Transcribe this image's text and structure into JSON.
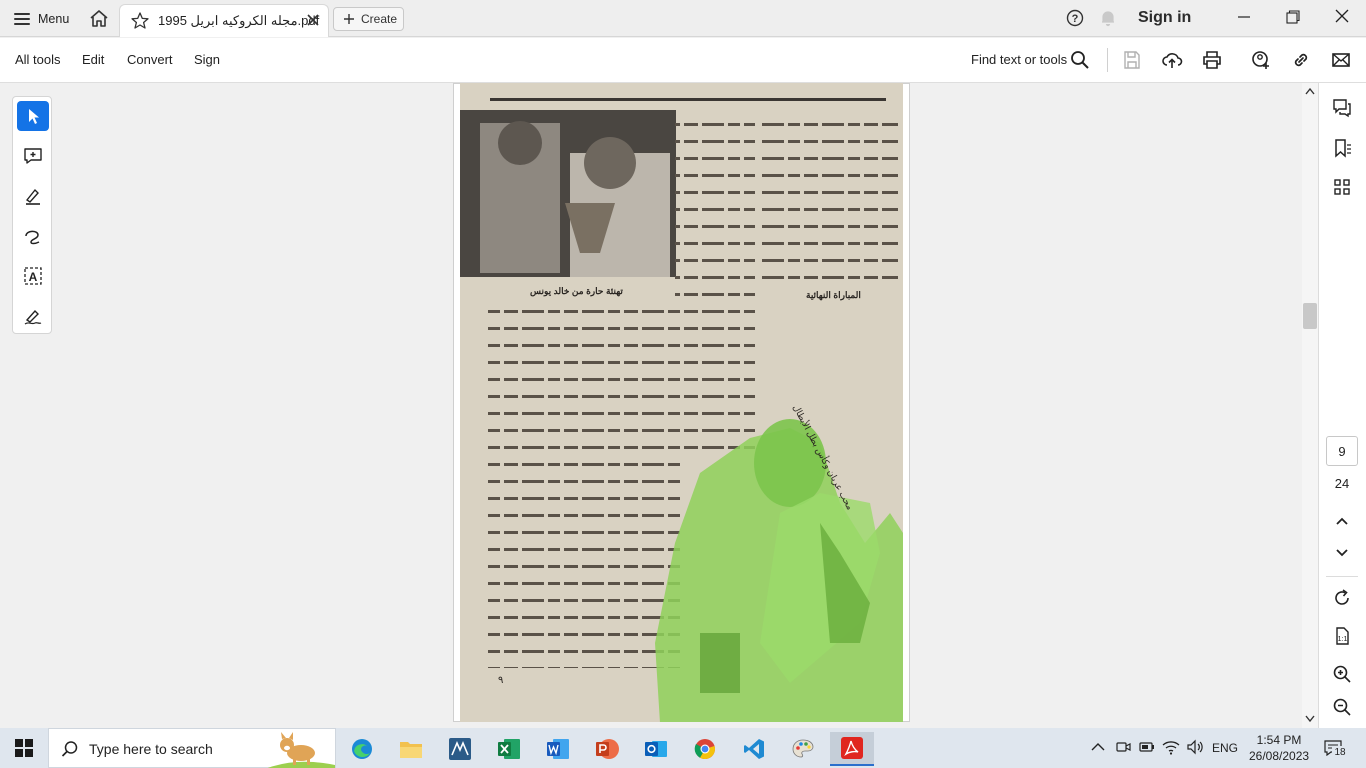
{
  "titlebar": {
    "menu_label": "Menu",
    "tab_title": "مجله الكروكيه ابريل 1995.pdf",
    "create_label": "Create",
    "signin_label": "Sign in"
  },
  "menubar": {
    "items": [
      "All tools",
      "Edit",
      "Convert",
      "Sign"
    ],
    "find_label": "Find text or tools"
  },
  "tools": [
    "select-tool",
    "add-comment-tool",
    "highlight-tool",
    "draw-tool",
    "text-recognition-tool",
    "fill-sign-tool"
  ],
  "document": {
    "caption": "تهنئة حارة من خالد يونس",
    "photo_caption": "محب عريان وكأس بطل الأبطال",
    "heading": "المباراة النهائية",
    "page_footer": "٩"
  },
  "rightrail": {
    "page_current": "9",
    "page_total": "24"
  },
  "taskbar": {
    "search_placeholder": "Type here to search",
    "lang": "ENG",
    "time": "1:54 PM",
    "date": "26/08/2023",
    "notifications": "18",
    "apps": [
      "edge",
      "file-explorer",
      "vpn",
      "excel",
      "word",
      "powerpoint",
      "outlook",
      "chrome",
      "vscode",
      "paint",
      "acrobat"
    ]
  },
  "colors": {
    "accent": "#1473e6",
    "scan_green": "#8fd15a",
    "acrobat_red": "#e0261f"
  }
}
